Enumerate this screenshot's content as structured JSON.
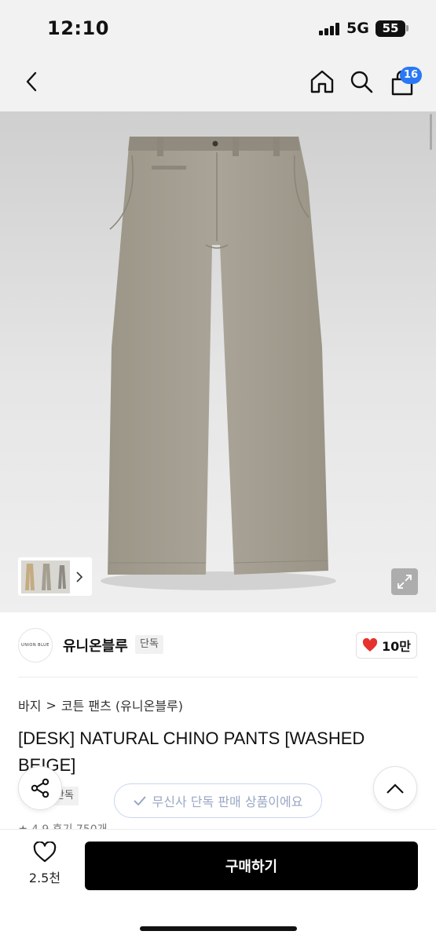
{
  "status_bar": {
    "time": "12:10",
    "network": "5G",
    "battery": "55"
  },
  "nav": {
    "cart_count": "16"
  },
  "brand": {
    "name": "유니온블루",
    "badge": "단독",
    "logo_text": "UNION BLUE",
    "likes": "10만"
  },
  "breadcrumb": {
    "category": "바지",
    "separator": ">",
    "subcategory": "코튼 팬츠 (유니온블루)"
  },
  "product": {
    "title": "[DESK] NATURAL CHINO PANTS [WASHED BEIGE]",
    "exclusive_tag": "단독",
    "rating_text": "★ 4.9 후기 750개"
  },
  "toast": {
    "message": "무신사 단독 판매 상품이에요"
  },
  "bottom": {
    "wish_count": "2.5천",
    "buy_label": "구매하기"
  },
  "colors": {
    "badge_blue": "#2b78f5",
    "heart_red": "#e5322d",
    "pants": "#a59f92",
    "buy_button": "#000000"
  },
  "icons": [
    "back-icon",
    "home-icon",
    "search-icon",
    "cart-icon",
    "chevron-right-icon",
    "expand-icon",
    "heart-icon",
    "share-icon",
    "chevron-up-icon",
    "check-icon"
  ]
}
